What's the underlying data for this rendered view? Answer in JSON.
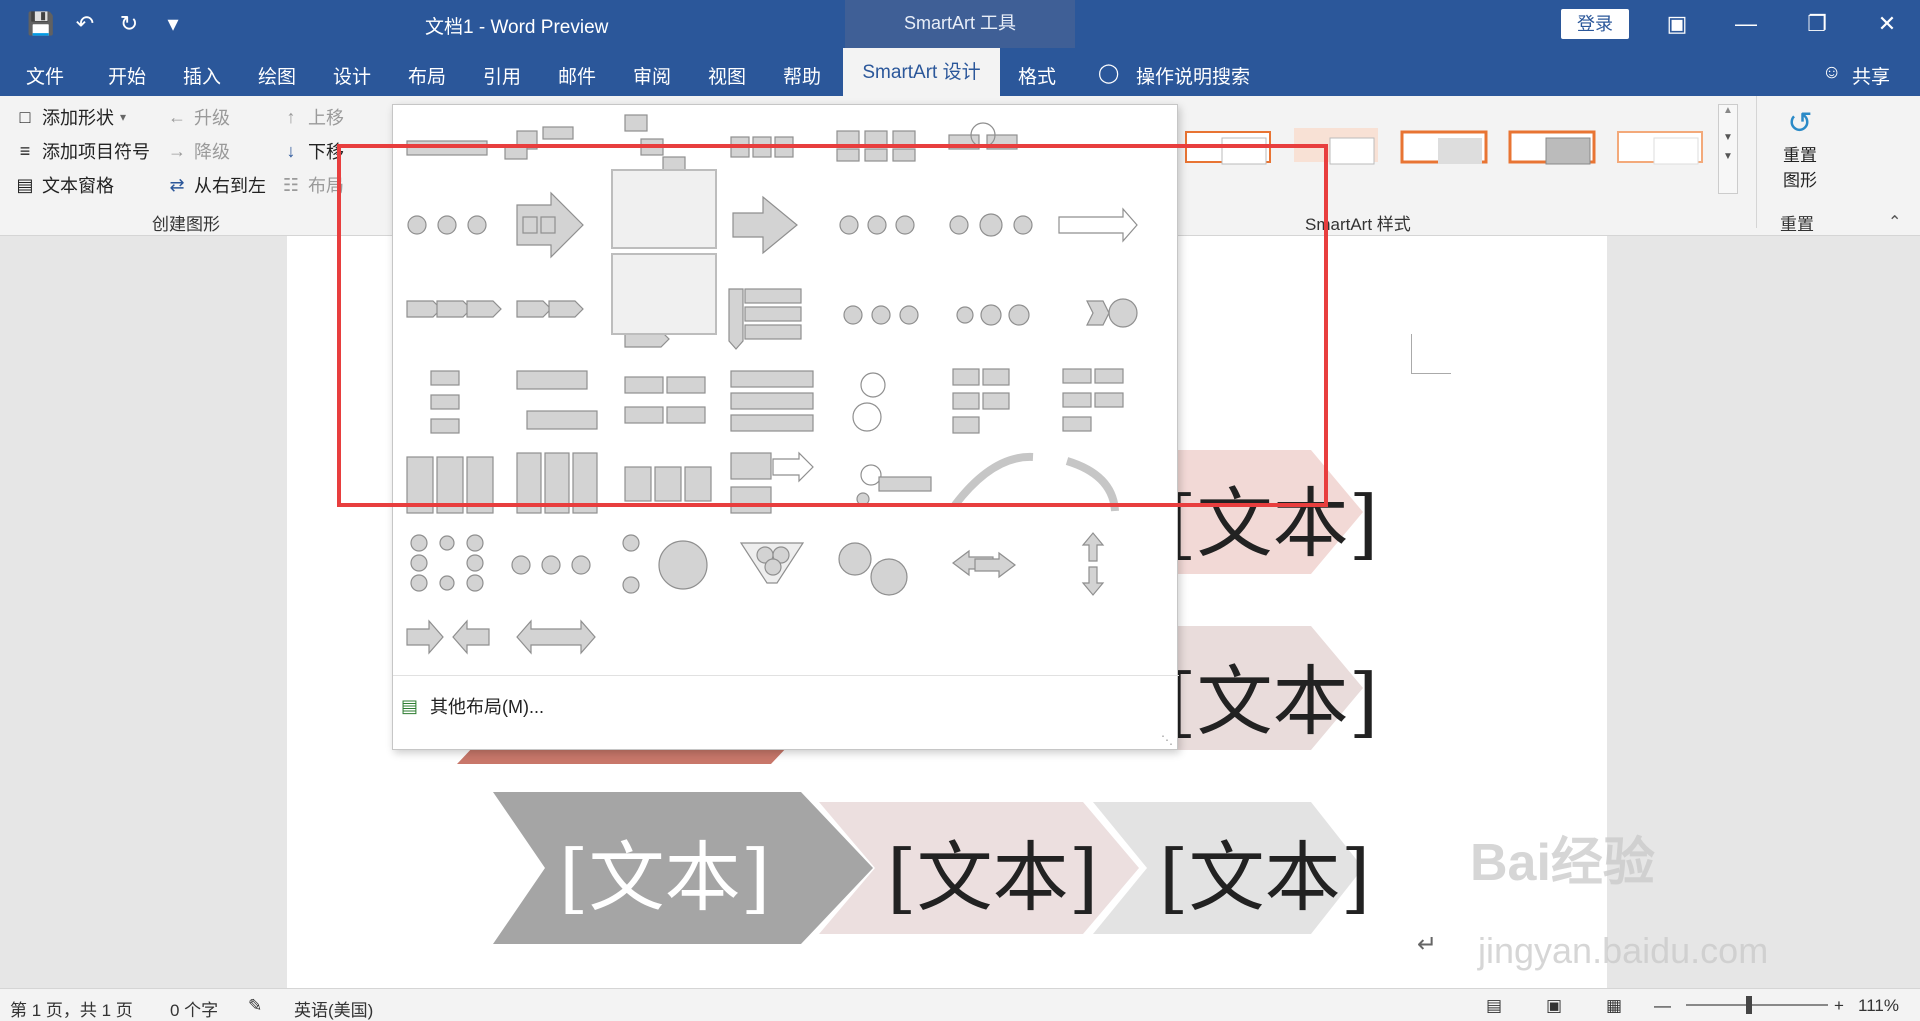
{
  "window": {
    "doc_title": "文档1  -  Word Preview",
    "context_tools": "SmartArt 工具",
    "login": "登录"
  },
  "tabs": [
    "文件",
    "开始",
    "插入",
    "绘图",
    "设计",
    "布局",
    "引用",
    "邮件",
    "审阅",
    "视图",
    "帮助",
    "SmartArt 设计",
    "格式"
  ],
  "tell_me": "操作说明搜索",
  "share": "共享",
  "ribbon": {
    "create_graphic": {
      "add_shape": "添加形状",
      "add_bullet": "添加项目符号",
      "text_pane": "文本窗格",
      "promote": "升级",
      "demote": "降级",
      "right_to_left": "从右到左",
      "move_up": "上移",
      "move_down": "下移",
      "layout": "布局",
      "group_label": "创建图形"
    },
    "styles_label": "SmartArt 样式",
    "reset": {
      "button_line1": "重置",
      "button_line2": "图形",
      "group_label": "重置"
    }
  },
  "gallery": {
    "more_layouts": "其他布局(M)..."
  },
  "document": {
    "placeholder": "[文本]"
  },
  "statusbar": {
    "page": "第 1 页，共 1 页",
    "words": "0 个字",
    "language": "英语(美国)",
    "zoom": "111%"
  },
  "watermark": {
    "brand": "Bai经验",
    "url": "jingyan.baidu.com"
  },
  "colors": {
    "title_bar": "#2b579a",
    "highlight": "#e83e3e",
    "chevron_gray": "#a5a5a5",
    "chevron_pink": "#efd9d8",
    "chevron_light": "#e4e4e4",
    "chevron_red": "#c8776a"
  }
}
